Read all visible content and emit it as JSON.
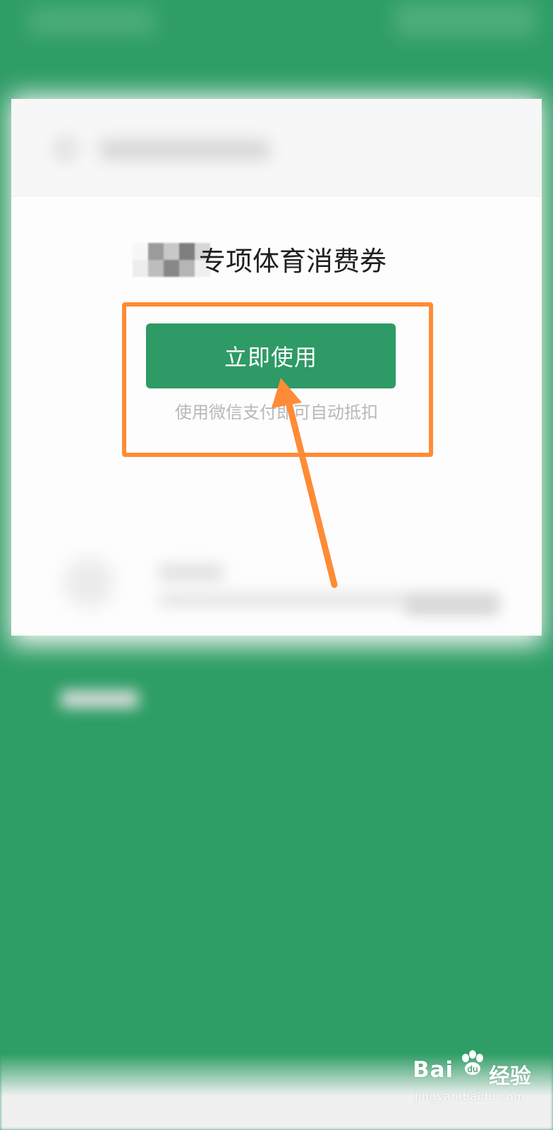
{
  "coupon": {
    "title_suffix": "专项体育消费券",
    "button_label": "立即使用",
    "hint": "使用微信支付即可自动抵扣"
  },
  "watermark": {
    "brand": "Bai",
    "suffix": "经验",
    "domain": "jingyan.baidu.com"
  },
  "colors": {
    "background": "#2e9e66",
    "button": "#2e9a65",
    "annotation": "#ff8b36"
  },
  "icons": {
    "watermark_logo": "paw-icon",
    "annotation_pointer": "arrow-icon"
  }
}
